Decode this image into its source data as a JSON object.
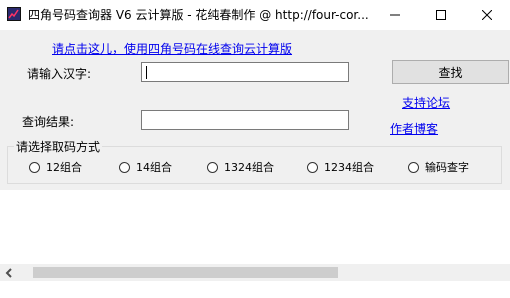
{
  "window": {
    "title": "四角号码查询器 V6 云计算版 - 花纯春制作 @ http://four-cor..."
  },
  "top_link": "请点击这儿，使用四角号码在线查询云计算版",
  "input": {
    "label": "请输入汉字:",
    "value": ""
  },
  "search_button": "查找",
  "support_link": "支持论坛",
  "result": {
    "label": "查询结果:",
    "value": ""
  },
  "blog_link": "作者博客",
  "mode_group": {
    "title": "请选择取码方式",
    "options": [
      {
        "label": "12组合",
        "selected": false
      },
      {
        "label": "14组合",
        "selected": false
      },
      {
        "label": "1324组合",
        "selected": false
      },
      {
        "label": "1234组合",
        "selected": false
      },
      {
        "label": "输码查字",
        "selected": false
      }
    ]
  },
  "icons": {
    "app": "app-logo-icon",
    "minimize": "minimize-icon",
    "maximize": "maximize-icon",
    "close": "close-icon",
    "scroll_left": "chevron-left-icon"
  },
  "colors": {
    "link": "#0000ee",
    "dialog_bg": "#f0f0f0",
    "button_bg": "#e1e1e1"
  }
}
